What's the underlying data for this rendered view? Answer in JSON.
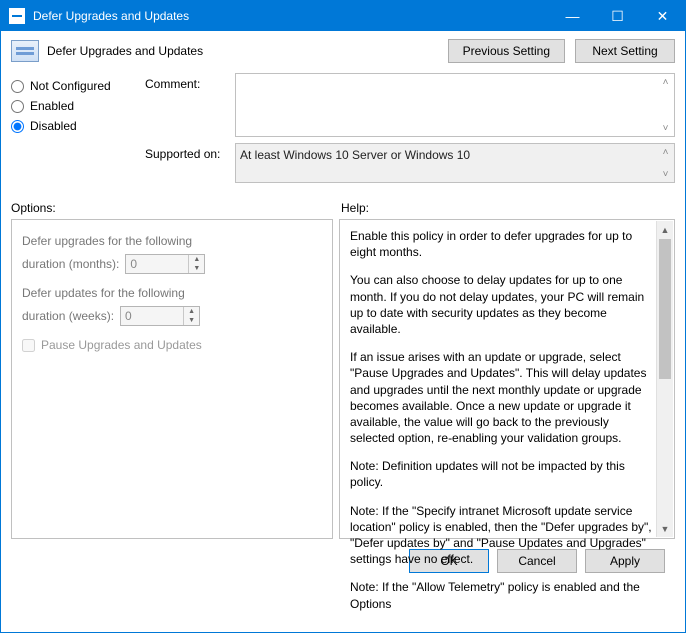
{
  "window": {
    "title": "Defer Upgrades and Updates"
  },
  "header": {
    "title": "Defer Upgrades and Updates",
    "prev_btn": "Previous Setting",
    "next_btn": "Next Setting"
  },
  "radios": {
    "not_configured": "Not Configured",
    "enabled": "Enabled",
    "disabled": "Disabled",
    "selected": "disabled"
  },
  "labels": {
    "comment": "Comment:",
    "supported_on": "Supported on:",
    "options": "Options:",
    "help": "Help:"
  },
  "supported_text": "At least Windows 10 Server or Windows 10",
  "options_panel": {
    "line1": "Defer upgrades for the following",
    "duration_months_label": "duration (months):",
    "duration_months_value": "0",
    "line2": "Defer updates for the following",
    "duration_weeks_label": "duration (weeks):",
    "duration_weeks_value": "0",
    "pause_label": "Pause Upgrades and Updates"
  },
  "help_panel": {
    "p1": "Enable this policy in order to defer upgrades for up to eight months.",
    "p2": "You can also choose to delay updates for up to one month. If you do not delay updates, your PC will remain up to date with security updates as they become available.",
    "p3": "If an issue arises with an update or upgrade, select \"Pause Upgrades and Updates\". This will delay updates and upgrades until the next monthly update or upgrade becomes available. Once a new update or upgrade it available, the value will go back to the previously selected option, re-enabling your validation groups.",
    "p4": "Note: Definition updates will not be impacted by this policy.",
    "p5": "Note: If the \"Specify intranet Microsoft update service location\" policy is enabled, then the \"Defer upgrades by\", \"Defer updates by\" and \"Pause Updates and Upgrades\" settings have no effect.",
    "p6": "Note: If the \"Allow Telemetry\" policy is enabled and the Options"
  },
  "footer": {
    "ok": "OK",
    "cancel": "Cancel",
    "apply": "Apply"
  }
}
